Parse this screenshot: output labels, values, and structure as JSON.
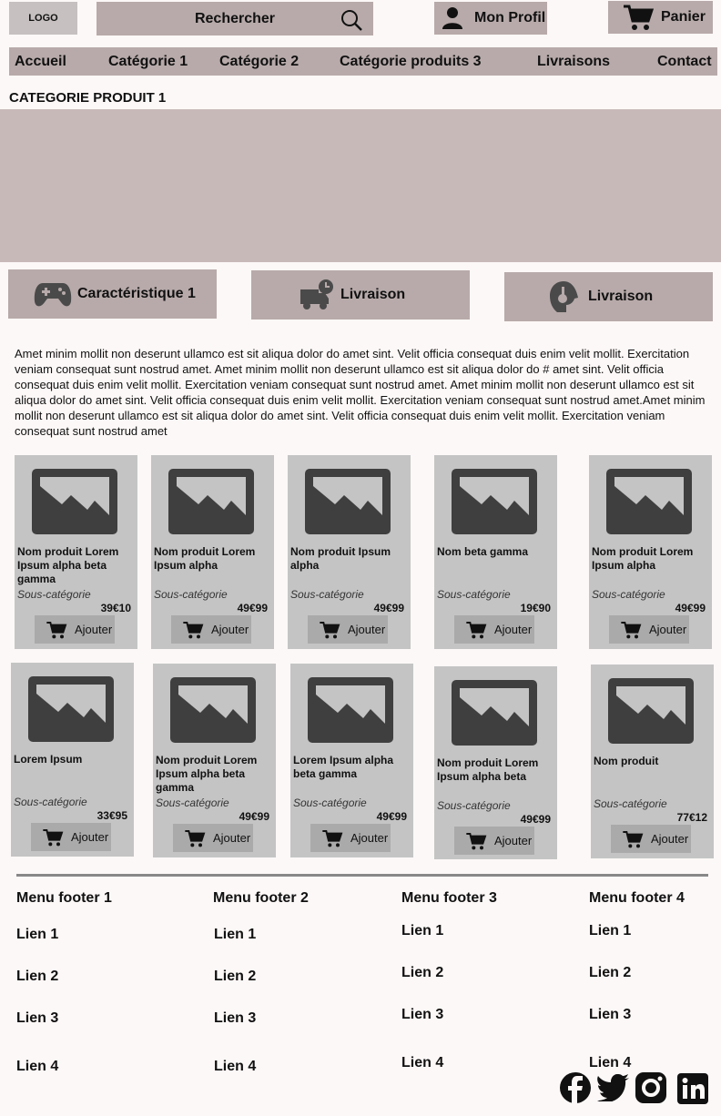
{
  "header": {
    "logo": "LOGO",
    "search_label": "Rechercher",
    "profile_label": "Mon Profil",
    "cart_label": "Panier"
  },
  "nav": [
    "Accueil",
    "Catégorie 1",
    "Catégorie 2",
    "Catégorie produits 3",
    "Livraisons",
    "Contact"
  ],
  "page_title": "CATEGORIE PRODUIT 1",
  "features": [
    {
      "label": "Caractéristique 1",
      "icon": "gamepad-icon"
    },
    {
      "label": "Livraison",
      "icon": "delivery-truck-icon"
    },
    {
      "label": "Livraison",
      "icon": "support-headset-icon"
    }
  ],
  "description": "Amet minim mollit non deserunt ullamco est sit aliqua dolor do amet sint. Velit officia consequat duis enim velit mollit. Exercitation veniam consequat sunt nostrud amet. Amet minim mollit non deserunt ullamco est sit aliqua dolor do # amet sint. Velit officia consequat duis enim velit mollit. Exercitation veniam consequat sunt nostrud amet. Amet minim mollit non deserunt ullamco est sit aliqua dolor do amet sint. Velit officia consequat duis enim velit mollit. Exercitation veniam consequat sunt nostrud amet.Amet minim mollit non deserunt ullamco est sit aliqua dolor do amet sint. Velit officia consequat duis enim velit mollit. Exercitation veniam consequat sunt nostrud amet",
  "products": [
    {
      "name": "Nom produit Lorem Ipsum alpha beta gamma",
      "sub": "Sous-catégorie",
      "price": "39€10",
      "add": "Ajouter"
    },
    {
      "name": "Nom produit Lorem Ipsum alpha",
      "sub": "Sous-catégorie",
      "price": "49€99",
      "add": "Ajouter"
    },
    {
      "name": "Nom produit Ipsum alpha",
      "sub": "Sous-catégorie",
      "price": "49€99",
      "add": "Ajouter"
    },
    {
      "name": "Nom beta gamma",
      "sub": "Sous-catégorie",
      "price": "19€90",
      "add": "Ajouter"
    },
    {
      "name": "Nom produit Lorem Ipsum alpha",
      "sub": "Sous-catégorie",
      "price": "49€99",
      "add": "Ajouter"
    },
    {
      "name": "Lorem Ipsum",
      "sub": "Sous-catégorie",
      "price": "33€95",
      "add": "Ajouter"
    },
    {
      "name": "Nom produit Lorem Ipsum alpha beta gamma",
      "sub": "Sous-catégorie",
      "price": "49€99",
      "add": "Ajouter"
    },
    {
      "name": "Lorem Ipsum alpha beta gamma",
      "sub": "Sous-catégorie",
      "price": "49€99",
      "add": "Ajouter"
    },
    {
      "name": "Nom produit Lorem Ipsum alpha beta",
      "sub": "Sous-catégorie",
      "price": "49€99",
      "add": "Ajouter"
    },
    {
      "name": "Nom produit",
      "sub": "Sous-catégorie",
      "price": "77€12",
      "add": "Ajouter"
    }
  ],
  "footer": [
    {
      "title": "Menu footer 1",
      "links": [
        "Lien 1",
        "Lien 2",
        "Lien 3",
        "Lien 4"
      ]
    },
    {
      "title": "Menu footer 2",
      "links": [
        "Lien 1",
        "Lien 2",
        "Lien 3",
        "Lien 4"
      ]
    },
    {
      "title": "Menu footer 3",
      "links": [
        "Lien 1",
        "Lien 2",
        "Lien 3",
        "Lien 4"
      ]
    },
    {
      "title": "Menu footer 4",
      "links": [
        "Lien 1",
        "Lien 2",
        "Lien 3",
        "Lien 4"
      ]
    }
  ],
  "social": [
    "facebook-icon",
    "twitter-icon",
    "instagram-icon",
    "linkedin-icon"
  ]
}
